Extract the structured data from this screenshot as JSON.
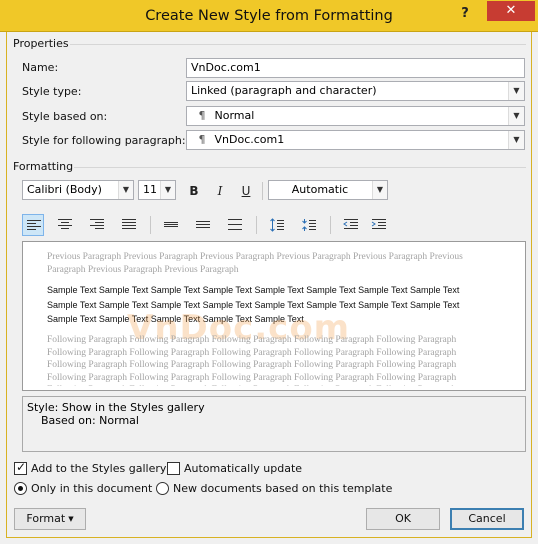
{
  "window": {
    "title": "Create New Style from Formatting",
    "help": "?",
    "close": "✕"
  },
  "properties": {
    "heading": "Properties",
    "name_label": "Name:",
    "name_value": "VnDoc.com1",
    "style_type_label": "Style type:",
    "style_type_value": "Linked (paragraph and character)",
    "based_on_label": "Style based on:",
    "based_on_value": "Normal",
    "following_label": "Style for following paragraph:",
    "following_value": "VnDoc.com1",
    "para_mark": "¶"
  },
  "formatting": {
    "heading": "Formatting",
    "font": "Calibri (Body)",
    "size": "11",
    "bold": "B",
    "italic": "I",
    "underline": "U",
    "color": "Automatic"
  },
  "preview": {
    "previous_paragraph": "Previous Paragraph Previous Paragraph Previous Paragraph Previous Paragraph Previous Paragraph Previous Paragraph Previous Paragraph Previous Paragraph",
    "sample_text": "Sample Text Sample Text Sample Text Sample Text Sample Text Sample Text Sample Text Sample Text Sample Text Sample Text Sample Text Sample Text Sample Text Sample Text Sample Text Sample Text Sample Text Sample Text Sample Text Sample Text Sample Text",
    "following_paragraph": "Following Paragraph Following Paragraph Following Paragraph Following Paragraph Following Paragraph Following Paragraph Following Paragraph Following Paragraph Following Paragraph Following Paragraph Following Paragraph Following Paragraph Following Paragraph Following Paragraph Following Paragraph Following Paragraph Following Paragraph Following Paragraph Following Paragraph Following Paragraph Following Paragraph Following Paragraph Following Paragraph Following Paragraph Following Paragraph",
    "watermark": "VnDoc.com"
  },
  "description": {
    "line1": "Style: Show in the Styles gallery",
    "line2": "Based on: Normal"
  },
  "options": {
    "add_to_gallery": "Add to the Styles gallery",
    "auto_update": "Automatically update",
    "only_this_document": "Only in this document",
    "new_documents": "New documents based on this template"
  },
  "buttons": {
    "format": "Format",
    "ok": "OK",
    "cancel": "Cancel"
  },
  "colors": {
    "titlebar": "#f0c828",
    "close": "#c73c32",
    "accent": "#3c7fb1"
  }
}
